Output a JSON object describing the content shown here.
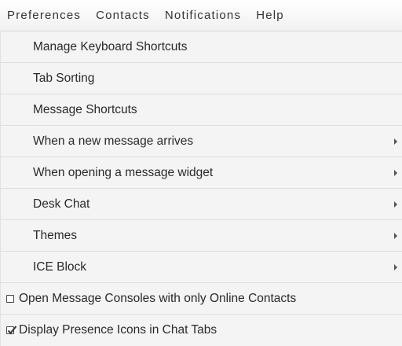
{
  "menubar": {
    "items": [
      {
        "label": "Preferences"
      },
      {
        "label": "Contacts"
      },
      {
        "label": "Notifications"
      },
      {
        "label": "Help"
      }
    ]
  },
  "dropdown": {
    "items": [
      {
        "label": "Manage Keyboard Shortcuts",
        "submenu": false
      },
      {
        "label": "Tab Sorting",
        "submenu": false
      },
      {
        "label": "Message Shortcuts",
        "submenu": false
      },
      {
        "label": "When a new message arrives",
        "submenu": true
      },
      {
        "label": "When opening a message widget",
        "submenu": true
      },
      {
        "label": "Desk Chat",
        "submenu": true
      },
      {
        "label": "Themes",
        "submenu": true
      },
      {
        "label": "ICE Block",
        "submenu": true
      }
    ],
    "checkbox_items": [
      {
        "label": "Open Message Consoles with only Online Contacts",
        "checked": false
      },
      {
        "label": "Display Presence Icons in Chat Tabs",
        "checked": true
      }
    ]
  }
}
